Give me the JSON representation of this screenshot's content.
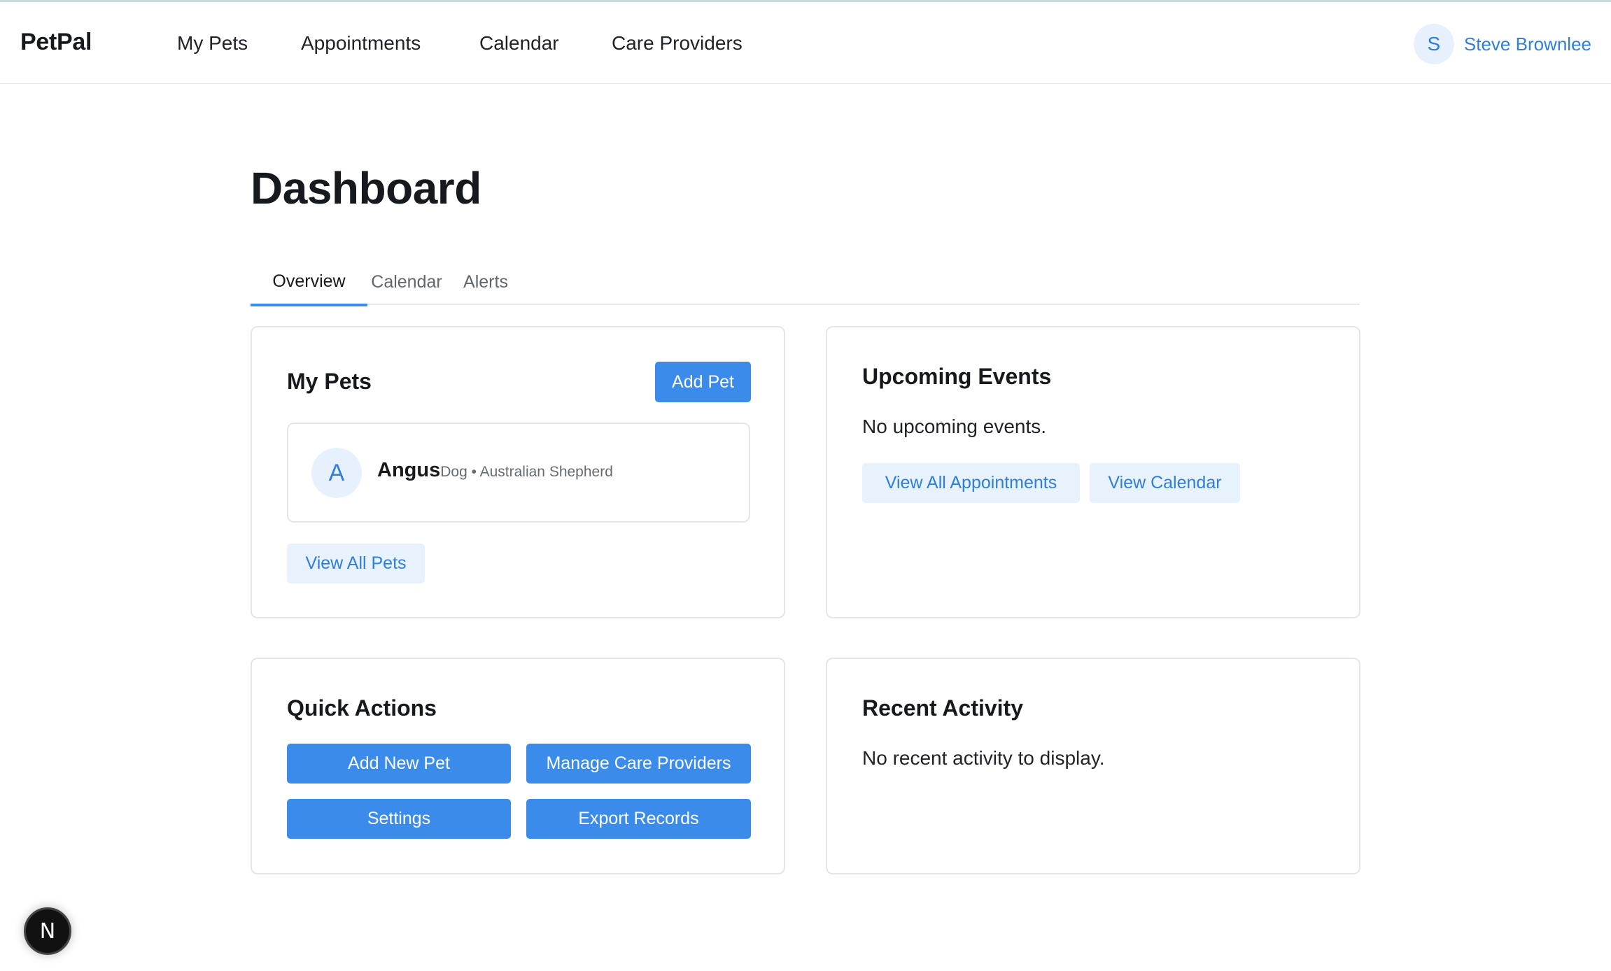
{
  "app": {
    "brand": "PetPal",
    "nav": [
      "My Pets",
      "Appointments",
      "Calendar",
      "Care Providers"
    ],
    "user": {
      "initial": "S",
      "name": "Steve Brownlee"
    }
  },
  "page": {
    "title": "Dashboard",
    "tabs": [
      {
        "label": "Overview",
        "active": true
      },
      {
        "label": "Calendar",
        "active": false
      },
      {
        "label": "Alerts",
        "active": false
      }
    ]
  },
  "my_pets": {
    "title": "My Pets",
    "add_button": "Add Pet",
    "pets": [
      {
        "initial": "A",
        "name": "Angus",
        "meta": "Dog • Australian Shepherd"
      }
    ],
    "view_all_button": "View All Pets"
  },
  "upcoming_events": {
    "title": "Upcoming Events",
    "empty_text": "No upcoming events.",
    "buttons": [
      "View All Appointments",
      "View Calendar"
    ]
  },
  "quick_actions": {
    "title": "Quick Actions",
    "buttons": [
      "Add New Pet",
      "Manage Care Providers",
      "Settings",
      "Export Records"
    ]
  },
  "recent_activity": {
    "title": "Recent Activity",
    "empty_text": "No recent activity to display."
  },
  "dev_badge": {
    "letter": "N",
    "icon": "nextjs-logo-icon"
  },
  "colors": {
    "accent": "#3b8beb",
    "accent_text": "#2f7fd8",
    "soft_button_bg": "#e8f2fd"
  }
}
